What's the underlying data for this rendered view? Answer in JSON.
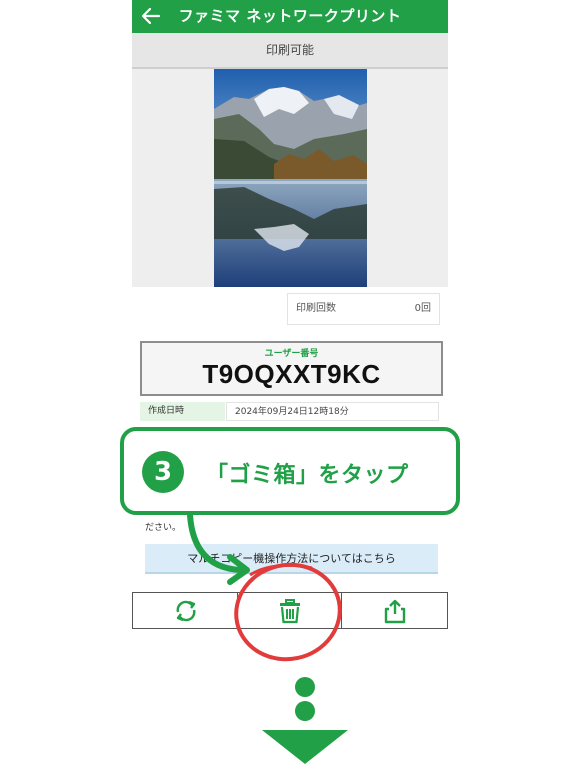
{
  "header": {
    "title": "ファミマ ネットワークプリント",
    "back_icon": "back-arrow-icon"
  },
  "status": {
    "text": "印刷可能"
  },
  "print_count": {
    "label": "印刷回数",
    "value": "0回"
  },
  "user_number": {
    "label": "ユーザー番号",
    "value": "T9OQXXT9KC"
  },
  "created": {
    "label": "作成日時",
    "value": "2024年09月24日12時18分"
  },
  "partial_text": "ださい。",
  "help_button": {
    "label": "マルチコピー機操作方法についてはこちら"
  },
  "toolbar": {
    "icons": [
      "refresh-icon",
      "trash-icon",
      "share-icon"
    ]
  },
  "callout": {
    "step": "3",
    "text": "「ゴミ箱」をタップ"
  },
  "colors": {
    "brand_green": "#21a047",
    "highlight_red": "#e23b3b",
    "help_blue": "#d9ecf8"
  }
}
